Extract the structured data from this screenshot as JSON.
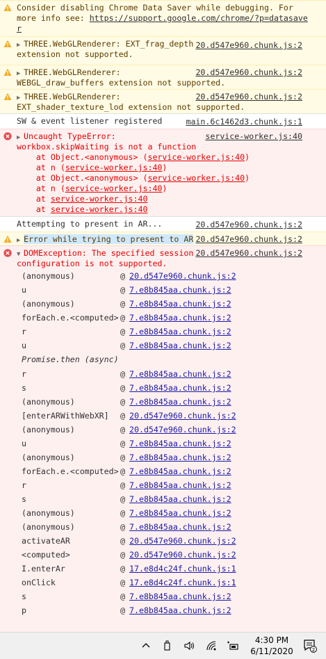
{
  "messages": [
    {
      "kind": "warn",
      "lines": [
        "Consider disabling Chrome Data Saver while debugging. For",
        "more info see: "
      ],
      "link": "https://support.google.com/chrome/?p=datasave",
      "link2": "r"
    },
    {
      "kind": "warn",
      "lines": [
        "THREE.WebGLRenderer: EXT_frag_depth",
        "extension not supported."
      ],
      "source": "20.d547e960.chunk.js:2"
    },
    {
      "kind": "warn",
      "lines": [
        "THREE.WebGLRenderer:",
        "WEBGL_draw_buffers extension not supported."
      ],
      "source": "20.d547e960.chunk.js:2"
    },
    {
      "kind": "warn",
      "lines": [
        "THREE.WebGLRenderer:",
        "EXT_shader_texture_lod extension not supported."
      ],
      "source": "20.d547e960.chunk.js:2"
    },
    {
      "kind": "info",
      "lines": [
        "SW & event listener registered"
      ],
      "source": "main.6c1462d3.chunk.js:1"
    },
    {
      "kind": "error",
      "lines": [
        "Uncaught TypeError:",
        "workbox.skipWaiting is not a function"
      ],
      "source": "service-worker.js:40",
      "stack": [
        {
          "pre": "    at Object.<anonymous> (",
          "link": "service-worker.js:40",
          "post": ")"
        },
        {
          "pre": "    at n (",
          "link": "service-worker.js:40",
          "post": ")"
        },
        {
          "pre": "    at Object.<anonymous> (",
          "link": "service-worker.js:40",
          "post": ")"
        },
        {
          "pre": "    at n (",
          "link": "service-worker.js:40",
          "post": ")"
        },
        {
          "pre": "    at ",
          "link": "service-worker.js:40",
          "post": ""
        },
        {
          "pre": "    at ",
          "link": "service-worker.js:40",
          "post": ""
        }
      ]
    },
    {
      "kind": "info",
      "lines": [
        "Attempting to present in AR..."
      ],
      "source": "20.d547e960.chunk.js:2"
    },
    {
      "kind": "warn",
      "lines": [
        "Error while trying to present to AR"
      ],
      "source": "20.d547e960.chunk.js:2"
    },
    {
      "kind": "error",
      "lines": [
        "DOMException: The specified session",
        "configuration is not supported."
      ],
      "source": "20.d547e960.chunk.js:2"
    }
  ],
  "frames": [
    {
      "name": "(anonymous)",
      "link": "20.d547e960.chunk.js:2"
    },
    {
      "name": "u",
      "link": "7.e8b845aa.chunk.js:2"
    },
    {
      "name": "(anonymous)",
      "link": "7.e8b845aa.chunk.js:2"
    },
    {
      "name": "forEach.e.<computed>",
      "link": "7.e8b845aa.chunk.js:2"
    },
    {
      "name": "r",
      "link": "7.e8b845aa.chunk.js:2"
    },
    {
      "name": "u",
      "link": "7.e8b845aa.chunk.js:2"
    },
    {
      "name": "Promise.then (async)",
      "async": true
    },
    {
      "name": "r",
      "link": "7.e8b845aa.chunk.js:2"
    },
    {
      "name": "s",
      "link": "7.e8b845aa.chunk.js:2"
    },
    {
      "name": "(anonymous)",
      "link": "7.e8b845aa.chunk.js:2"
    },
    {
      "name": "[enterARWithWebXR]",
      "link": "20.d547e960.chunk.js:2"
    },
    {
      "name": "(anonymous)",
      "link": "20.d547e960.chunk.js:2"
    },
    {
      "name": "u",
      "link": "7.e8b845aa.chunk.js:2"
    },
    {
      "name": "(anonymous)",
      "link": "7.e8b845aa.chunk.js:2"
    },
    {
      "name": "forEach.e.<computed>",
      "link": "7.e8b845aa.chunk.js:2"
    },
    {
      "name": "r",
      "link": "7.e8b845aa.chunk.js:2"
    },
    {
      "name": "s",
      "link": "7.e8b845aa.chunk.js:2"
    },
    {
      "name": "(anonymous)",
      "link": "7.e8b845aa.chunk.js:2"
    },
    {
      "name": "(anonymous)",
      "link": "7.e8b845aa.chunk.js:2"
    },
    {
      "name": "activateAR",
      "link": "20.d547e960.chunk.js:2"
    },
    {
      "name": "<computed>",
      "link": "20.d547e960.chunk.js:2"
    },
    {
      "name": "I.enterAr",
      "link": "17.e8d4c24f.chunk.js:1"
    },
    {
      "name": "onClick",
      "link": "17.e8d4c24f.chunk.js:1"
    },
    {
      "name": "s",
      "link": "7.e8b845aa.chunk.js:2"
    },
    {
      "name": "p",
      "link": "7.e8b845aa.chunk.js:2"
    }
  ],
  "at_symbol": "@",
  "taskbar": {
    "time": "4:30 PM",
    "date": "6/11/2020",
    "notification_count": "2"
  },
  "colors": {
    "warn_bg": "#fffbe5",
    "error_bg": "#fff0f0",
    "error_text": "#e60000",
    "link_blue": "#1a1aa6"
  }
}
